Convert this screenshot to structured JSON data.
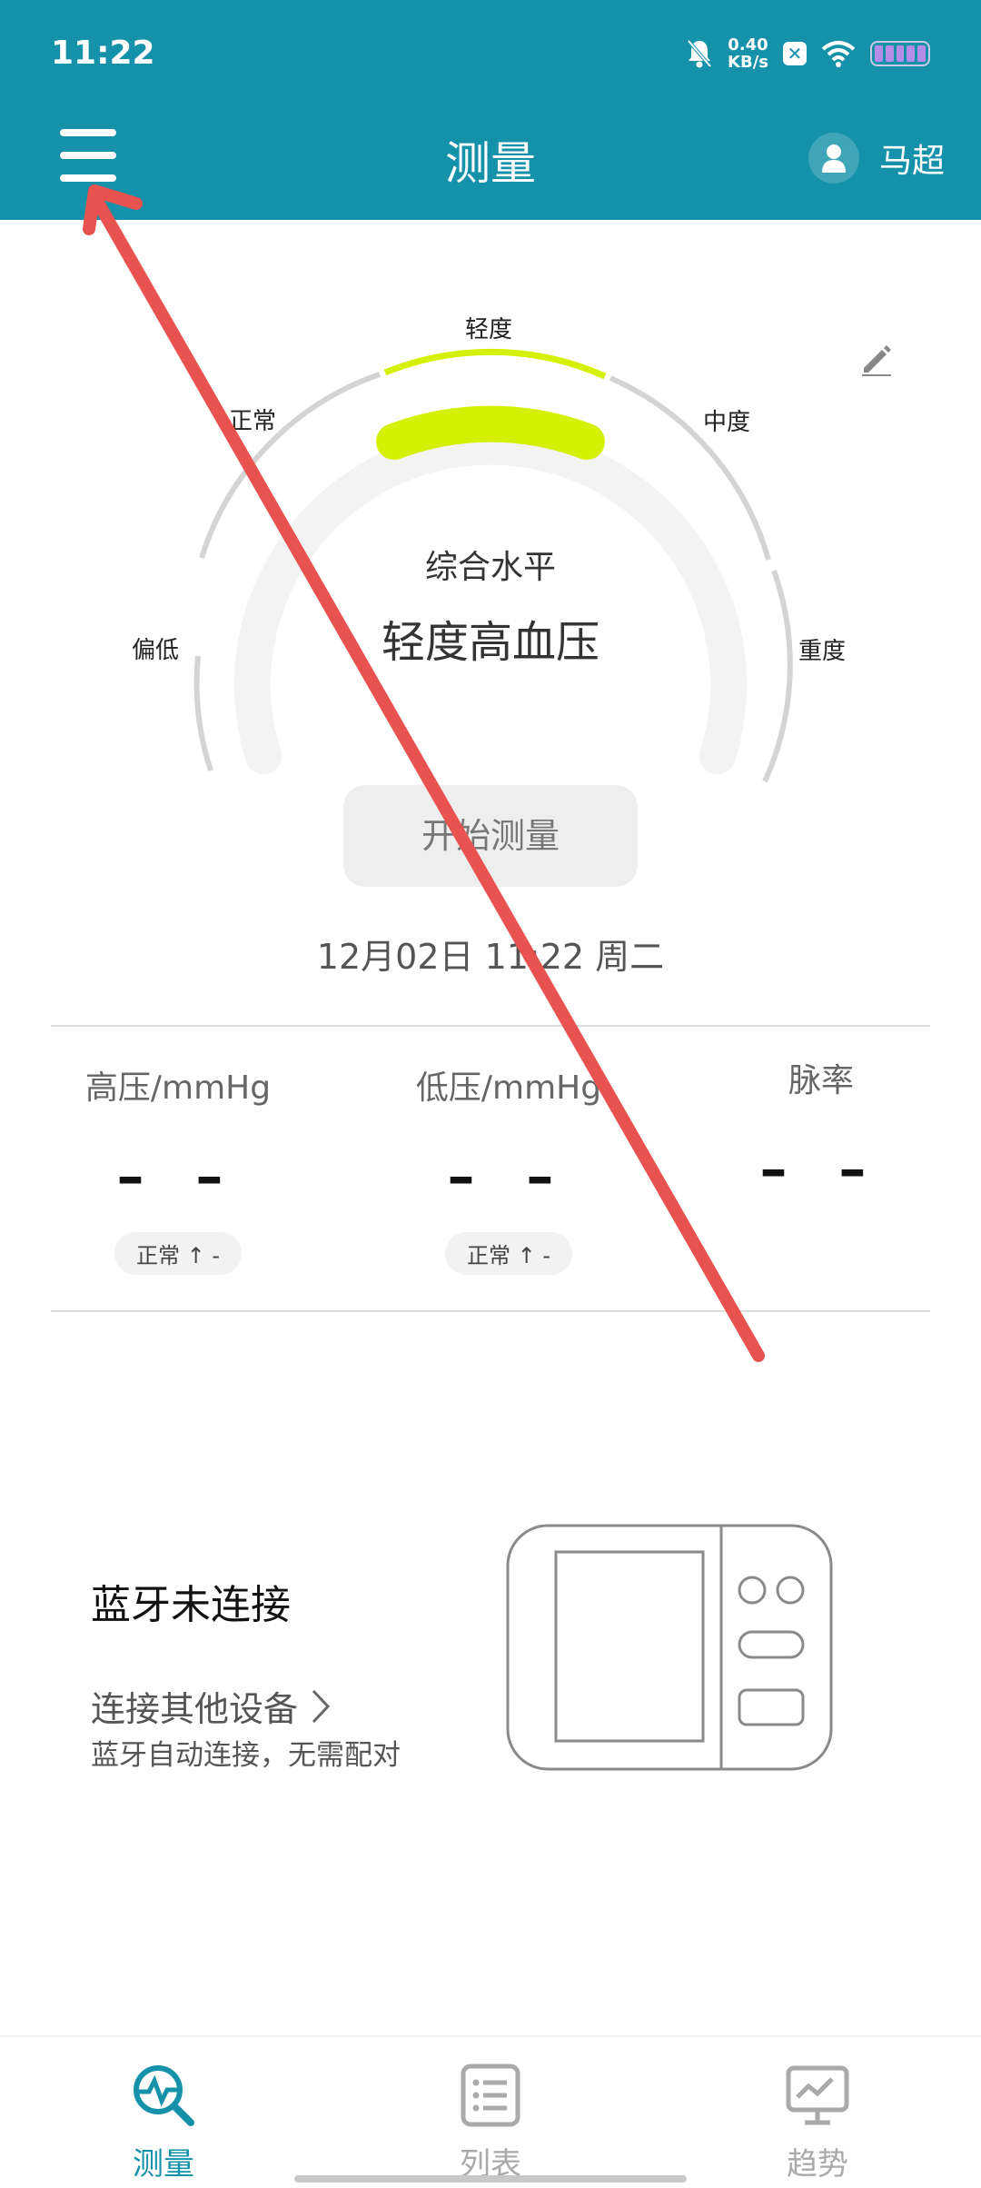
{
  "status_bar": {
    "time": "11:22",
    "net_speed_value": "0.40",
    "net_speed_unit": "KB/s",
    "icons": [
      "mute-bell-icon",
      "x-badge-icon",
      "wifi-icon",
      "battery-icon"
    ]
  },
  "header": {
    "title": "测量",
    "user_name": "马超",
    "bg_color": "#1592a9"
  },
  "gauge": {
    "labels": {
      "low": "偏低",
      "normal": "正常",
      "mild": "轻度",
      "moderate": "中度",
      "severe": "重度"
    },
    "active_segment": "mild",
    "active_color": "#d6f005",
    "level_caption": "综合水平",
    "level_value": "轻度高血压"
  },
  "actions": {
    "start_measure": "开始测量"
  },
  "measurement_time": "12月02日 11:22 周二",
  "metrics": [
    {
      "label": "高压/mmHg",
      "value": "– –",
      "status": "正常 ↑ -"
    },
    {
      "label": "低压/mmHg",
      "value": "– –",
      "status": "正常 ↑ -"
    },
    {
      "label": "脉率",
      "value": "– –"
    }
  ],
  "bluetooth": {
    "title": "蓝牙未连接",
    "link": "连接其他设备",
    "subtitle": "蓝牙自动连接，无需配对"
  },
  "bottom_nav": {
    "active_color": "#1592a9",
    "inactive_color": "#aaaaaa",
    "items": [
      {
        "label": "测量",
        "icon": "measure-search-icon",
        "active": true
      },
      {
        "label": "列表",
        "icon": "list-icon",
        "active": false
      },
      {
        "label": "趋势",
        "icon": "trend-chart-icon",
        "active": false
      }
    ]
  },
  "annotation": {
    "type": "arrow",
    "color": "#e8524f"
  }
}
